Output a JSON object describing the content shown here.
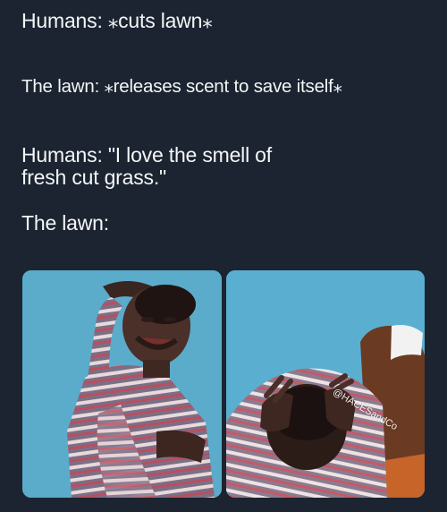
{
  "caption": {
    "line1": "Humans: ⁎cuts lawn⁎",
    "line2": "The lawn: ⁎releases scent to save itself⁎",
    "line3": "Humans: \"I love the smell of fresh cut grass.\"",
    "line4": "The lawn:"
  },
  "images": {
    "left": "crying-child-icon",
    "right": "head-in-hands-child-icon"
  },
  "watermark": "@HACESandCo",
  "colors": {
    "background": "#1b2430",
    "text": "#f4f6f8",
    "photo_wall": "#5fb0cf"
  }
}
